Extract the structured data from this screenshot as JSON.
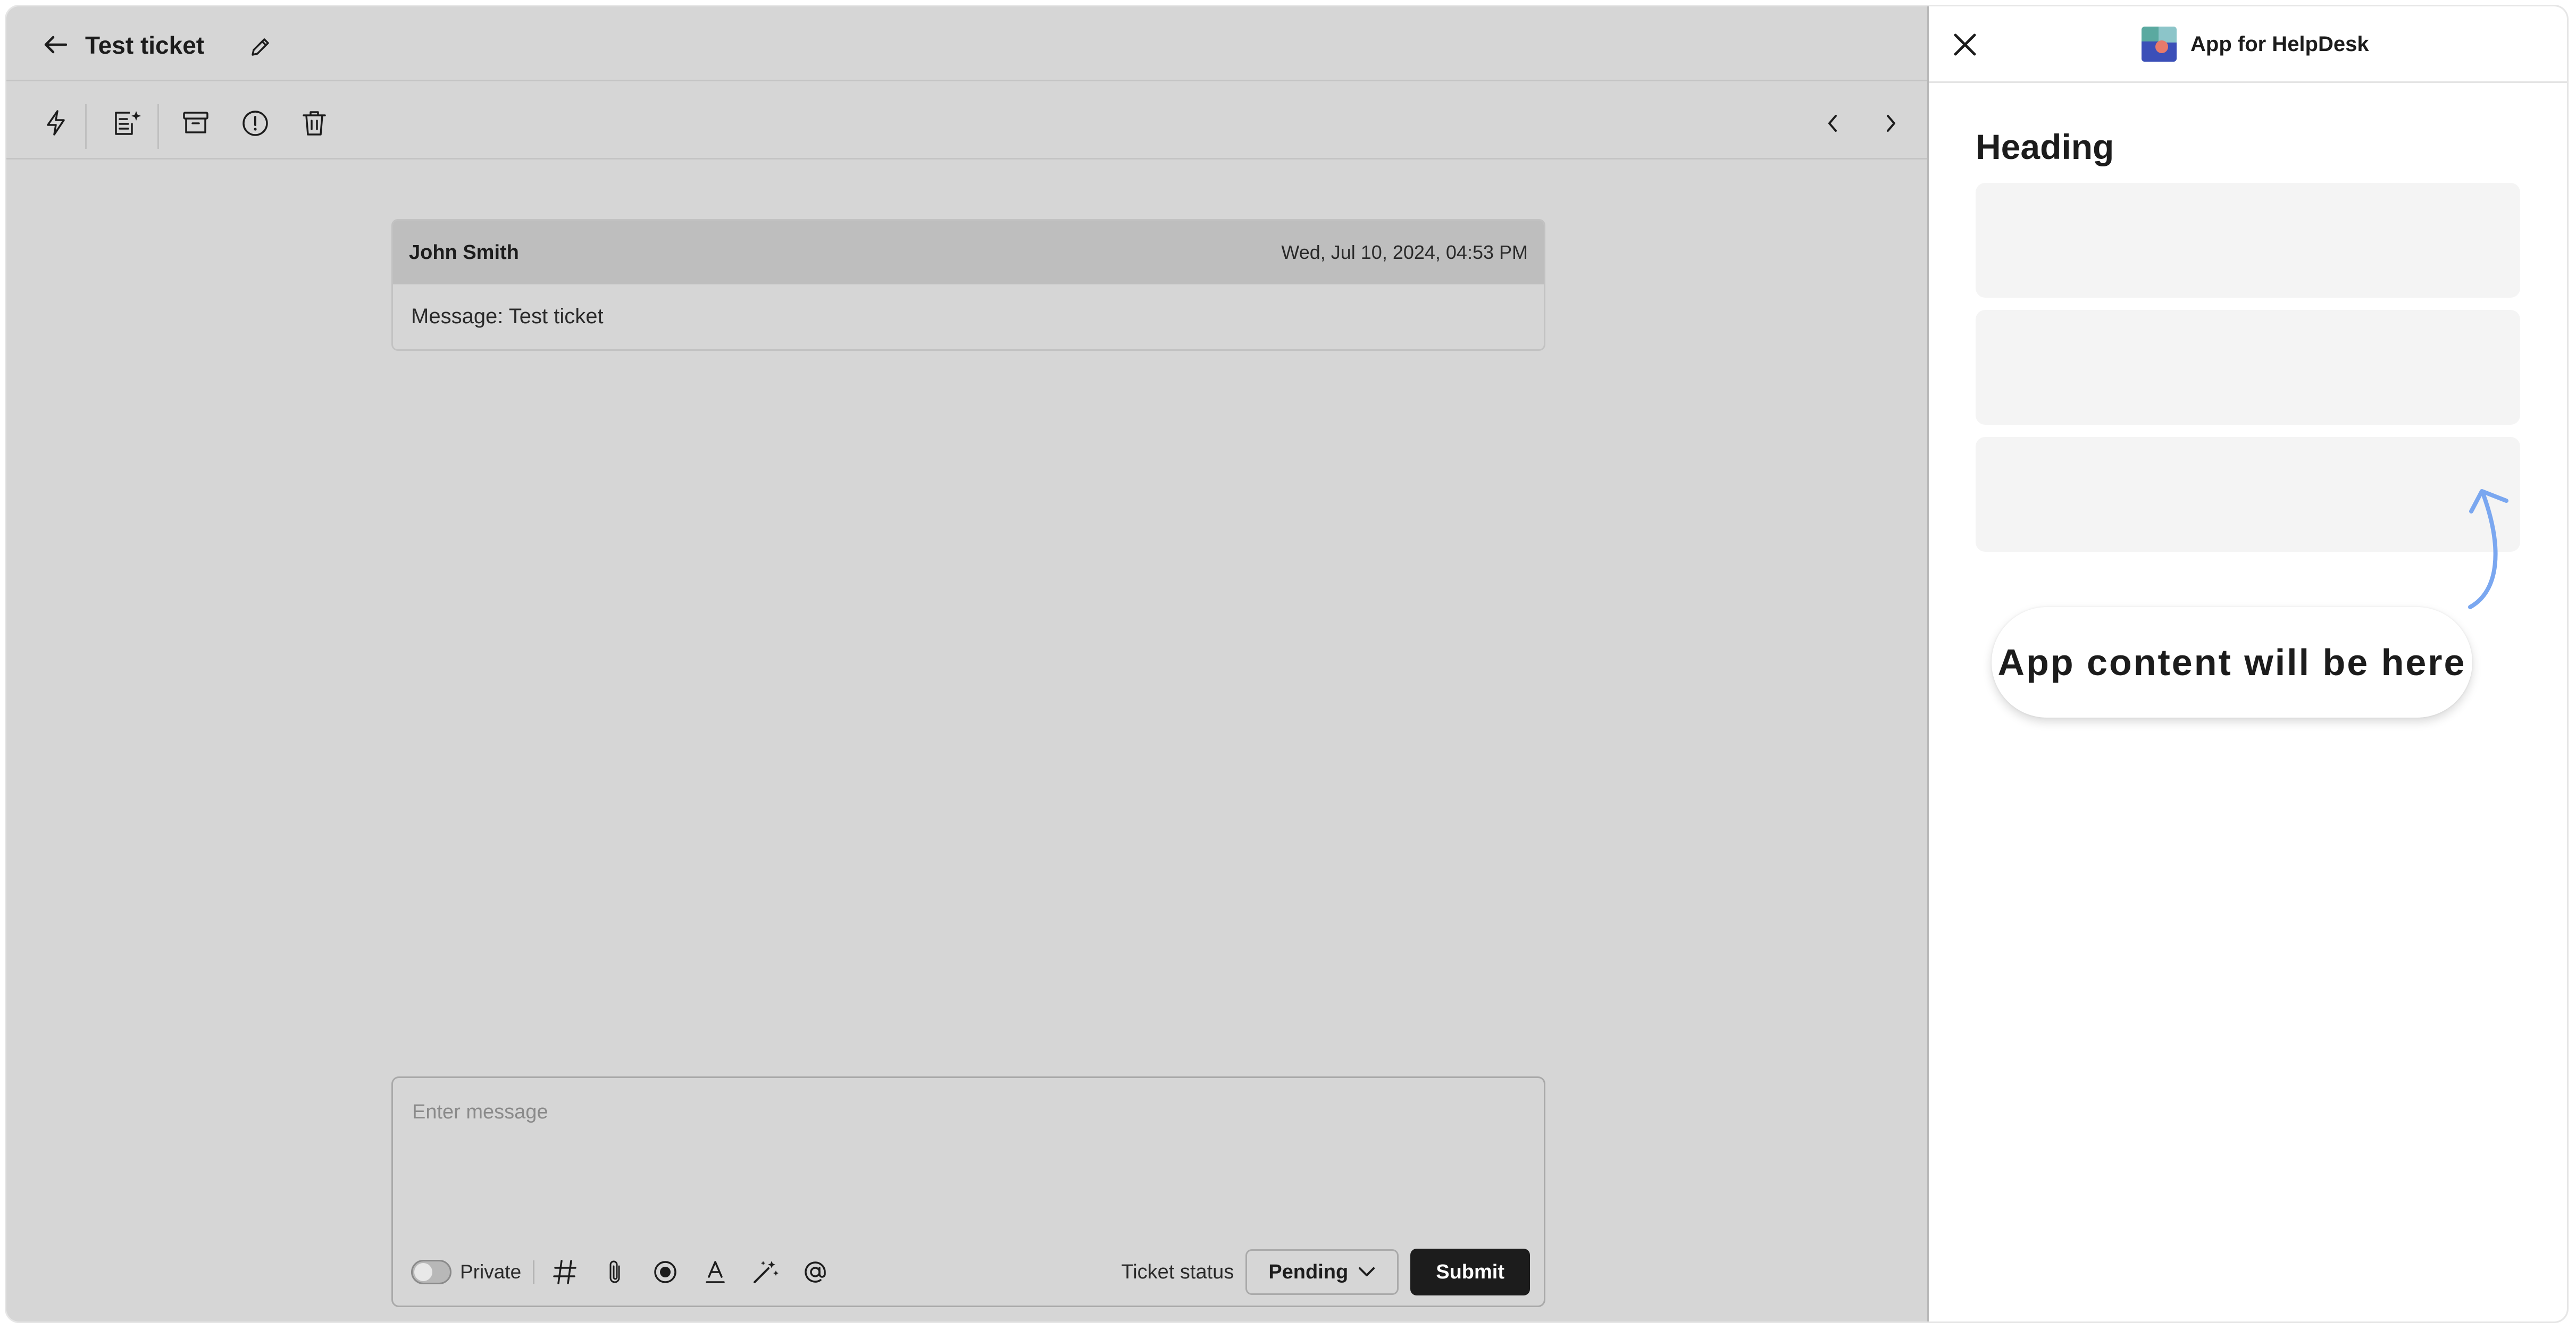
{
  "ticket": {
    "title": "Test ticket"
  },
  "message": {
    "author": "John Smith",
    "date": "Wed, Jul 10, 2024, 04:53 PM",
    "body": "Message: Test ticket"
  },
  "composer": {
    "placeholder": "Enter message",
    "private_label": "Private",
    "status_label": "Ticket status",
    "status_value": "Pending",
    "submit_label": "Submit"
  },
  "app_panel": {
    "title": "App for HelpDesk",
    "heading": "Heading",
    "callout": "App content will be here"
  },
  "icons": {
    "back": "arrow-left-icon",
    "edit": "pencil-icon",
    "macro": "lightning-icon",
    "ai_summary": "document-sparkle-icon",
    "archive": "archive-box-icon",
    "spam": "alert-circle-icon",
    "delete": "trash-icon",
    "prev": "chevron-left-icon",
    "next": "chevron-right-icon",
    "close": "close-icon"
  },
  "colors": {
    "overlay_gray": "#d6d6d6",
    "submit_bg": "#1c1c1c",
    "callout_arrow": "#7aa7f0"
  }
}
